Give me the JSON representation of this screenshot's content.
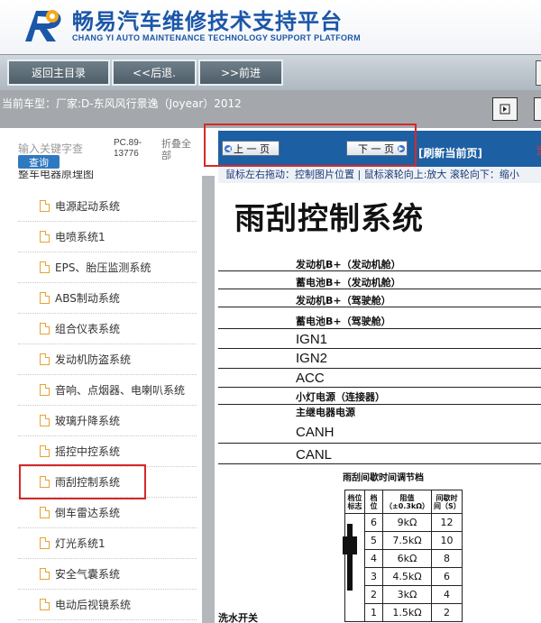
{
  "header": {
    "title": "畅易汽车维修技术支持平台",
    "subtitle": "CHANG YI AUTO MAINTENANCE TECHNOLOGY SUPPORT PLATFORM"
  },
  "nav": {
    "home": "返回主目录",
    "back": "<<后退.",
    "forward": ">>前进"
  },
  "vehicle": {
    "text": "当前车型：厂家:D-东风风行景逸（Joyear）2012"
  },
  "search": {
    "placeholder": "输入关键字查",
    "button": "查询",
    "pc_code": "PC.89-13776",
    "collapse": "折叠全部"
  },
  "tree": {
    "partial": "整车电器原理图",
    "items": [
      "电源起动系统",
      "电喷系统1",
      "EPS、胎压监测系统",
      "ABS制动系统",
      "组合仪表系统",
      "发动机防盗系统",
      "音响、点烟器、电喇叭系统",
      "玻璃升降系统",
      "摇控中控系统",
      "雨刮控制系统",
      "倒车雷达系统",
      "灯光系统1",
      "安全气囊系统",
      "电动后视镜系统"
    ],
    "selected": "雨刮控制系统"
  },
  "viewer": {
    "prev": "上 一 页",
    "next": "下 一 页",
    "refresh": "[刷新当前页]",
    "tip": "当",
    "hint": "鼠标左右拖动：控制图片位置 | 鼠标滚轮向上:放大  滚轮向下：缩小"
  },
  "diagram": {
    "title": "雨刮控制系统",
    "labels": [
      "发动机B+（发动机舱）",
      "蓄电池B+（发动机舱）",
      "发动机B+（驾驶舱）",
      "蓄电池B+（驾驶舱）",
      "IGN1",
      "IGN2",
      "ACC",
      "小灯电源（连接器）",
      "主继电器电源",
      "CANH",
      "CANL"
    ],
    "table_title": "雨刮间歇时间调节档",
    "table_headers": [
      "档位标志",
      "档位",
      "阻值（±0.3kΩ）",
      "间歇时间（S）"
    ],
    "table_rows": [
      [
        "6",
        "9kΩ",
        "12"
      ],
      [
        "5",
        "7.5kΩ",
        "10"
      ],
      [
        "4",
        "6kΩ",
        "8"
      ],
      [
        "3",
        "4.5kΩ",
        "6"
      ],
      [
        "2",
        "3kΩ",
        "4"
      ],
      [
        "1",
        "1.5kΩ",
        "2"
      ]
    ],
    "bottom": "洗水开关"
  }
}
